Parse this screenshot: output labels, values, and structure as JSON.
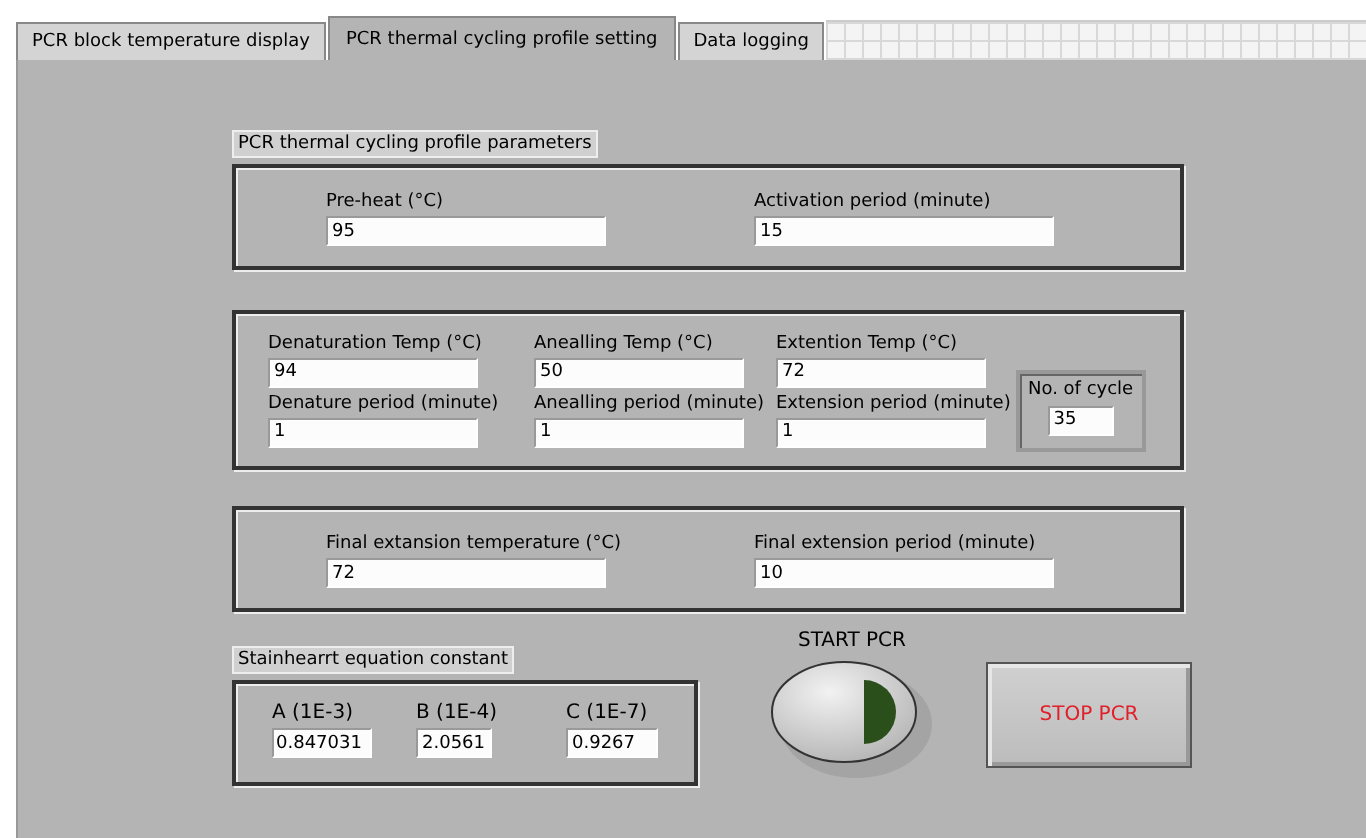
{
  "tabs": [
    {
      "label": "PCR block temperature display",
      "selected": false
    },
    {
      "label": "PCR thermal cycling profile setting",
      "selected": true
    },
    {
      "label": "Data logging",
      "selected": false
    }
  ],
  "profile": {
    "title": "PCR thermal cycling profile parameters",
    "fields": [
      {
        "label": "Pre-heat (°C)",
        "value": "95"
      },
      {
        "label": "Activation period (minute)",
        "value": "15"
      }
    ]
  },
  "cycling": {
    "fields": [
      {
        "label": "Denaturation Temp (°C)",
        "value": "94"
      },
      {
        "label": "Anealling Temp (°C)",
        "value": "50"
      },
      {
        "label": "Extention Temp (°C)",
        "value": "72"
      },
      {
        "label": "Denature period (minute)",
        "value": "1"
      },
      {
        "label": "Anealling period (minute)",
        "value": "1"
      },
      {
        "label": "Extension period (minute)",
        "value": "1"
      }
    ],
    "cycles": {
      "label": "No. of cycle",
      "value": "35"
    }
  },
  "final": {
    "fields": [
      {
        "label": "Final extansion temperature (°C)",
        "value": "72"
      },
      {
        "label": "Final extension period (minute)",
        "value": "10"
      }
    ]
  },
  "constants": {
    "title": "Stainhearrt equation constant",
    "fields": [
      {
        "label": "A (1E-3)",
        "value": "0.847031"
      },
      {
        "label": "B  (1E-4)",
        "value": "2.0561"
      },
      {
        "label": "C  (1E-7)",
        "value": "0.9267"
      }
    ]
  },
  "start_button": {
    "label": "START PCR"
  },
  "stop_button": {
    "label": "STOP PCR"
  }
}
